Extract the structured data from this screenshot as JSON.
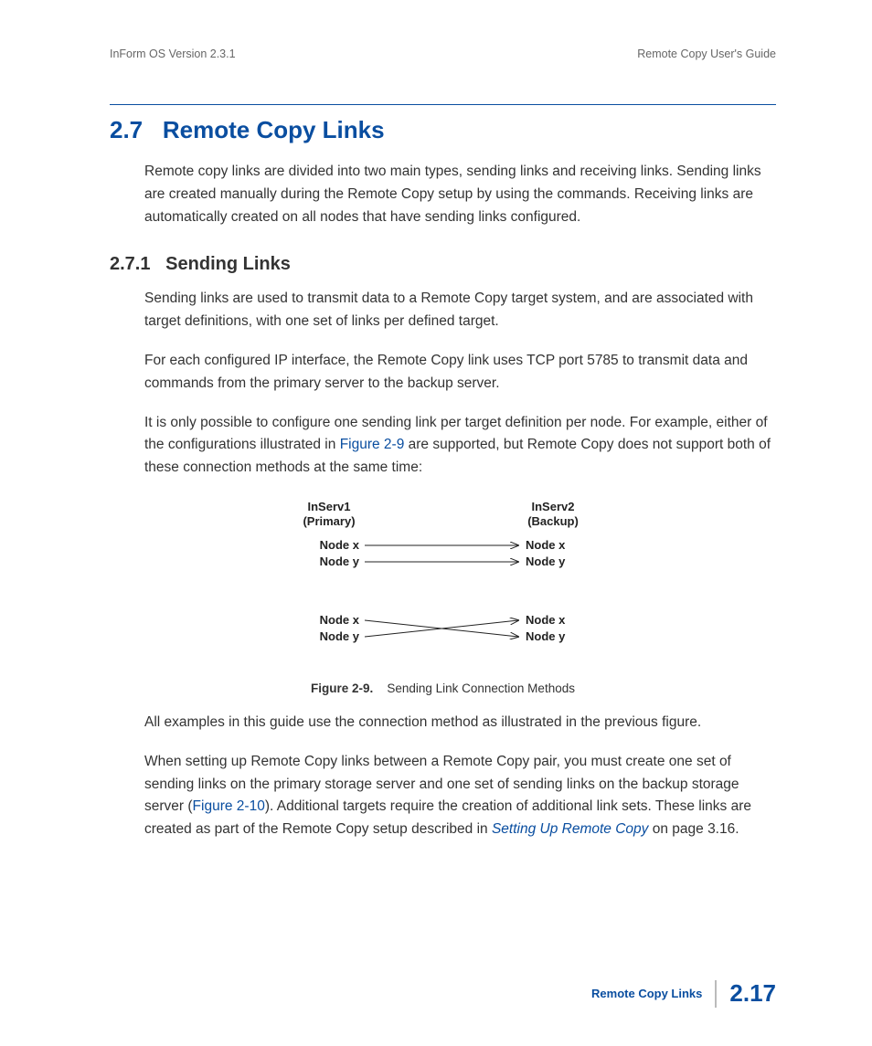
{
  "header": {
    "left": "InForm OS Version 2.3.1",
    "right": "Remote Copy User's Guide"
  },
  "section": {
    "number": "2.7",
    "title": "Remote Copy Links",
    "intro_pre": "Remote copy links are divided into two main types, sending links and receiving links. Sending links are created manually during the Remote Copy setup by using the ",
    "intro_post": " commands. Receiving links are automatically created on all nodes that have sending links configured."
  },
  "subsection": {
    "number": "2.7.1",
    "title": "Sending Links",
    "p1": "Sending links are used to transmit data to a Remote Copy target system, and are associated with target definitions, with one set of links per defined target.",
    "p2": "For each configured IP interface, the Remote Copy link uses TCP port 5785 to transmit data and commands from the primary server to the backup server.",
    "p3_pre": "It is only possible to configure one sending link per target definition per node. For example, either of the configurations illustrated in ",
    "p3_ref": "Figure 2-9",
    "p3_post": " are supported, but Remote Copy does not support both of these connection methods at the same time:"
  },
  "diagram": {
    "left_title1": "InServ1",
    "left_title2": "(Primary)",
    "right_title1": "InServ2",
    "right_title2": "(Backup)",
    "nodex": "Node x",
    "nodey": "Node y"
  },
  "figure": {
    "label": "Figure 2-9.",
    "text": "Sending Link Connection Methods"
  },
  "after": {
    "p4": "All examples in this guide use the connection method as illustrated in the previous figure.",
    "p5_pre": "When setting up Remote Copy links between a Remote Copy pair, you must create one set of sending links on the primary storage server and one set of sending links on the backup storage server (",
    "p5_ref": "Figure 2-10",
    "p5_mid": "). Additional targets require the creation of additional link sets. These links are created as part of the Remote Copy setup described in ",
    "p5_xref": "Setting Up Remote Copy",
    "p5_post": " on page 3.16."
  },
  "footer": {
    "label": "Remote Copy Links",
    "pagenum": "2.17"
  }
}
